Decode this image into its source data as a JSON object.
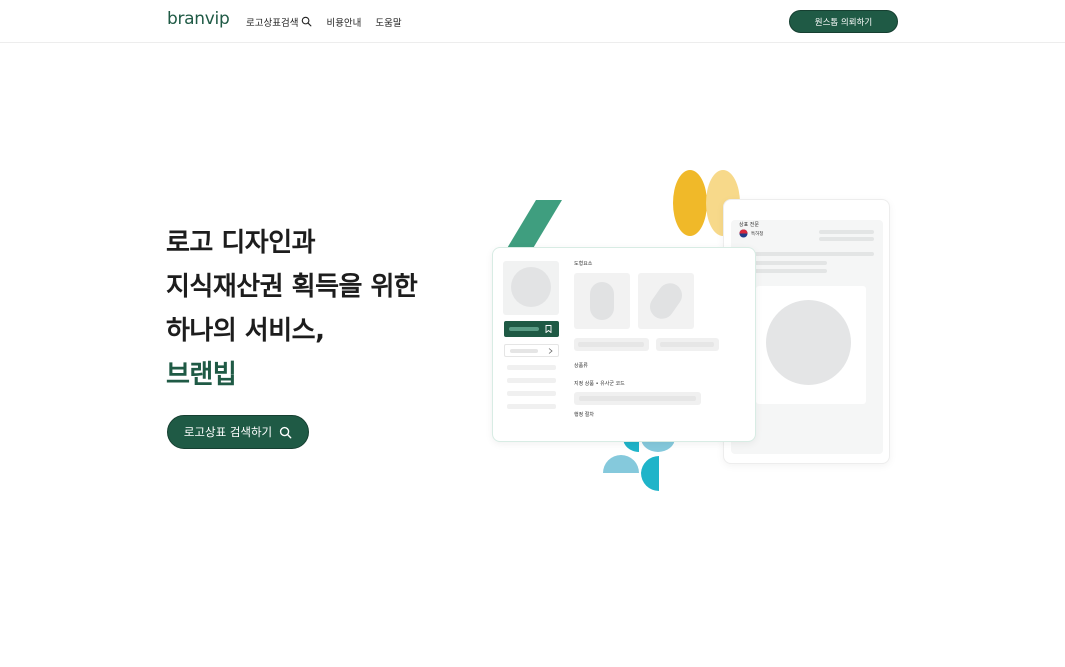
{
  "header": {
    "logo": "branvip",
    "nav": [
      {
        "label": "로고상표검색"
      },
      {
        "label": "비용안내"
      },
      {
        "label": "도움말"
      }
    ],
    "cta_label": "원스톱 의뢰하기"
  },
  "hero": {
    "line1": "로고 디자인과",
    "line2": "지식재산권 획득을 위한",
    "line3": "하나의 서비스,",
    "brand": "브랜빕",
    "cta_label": "로고상표 검색하기"
  },
  "illustration": {
    "card_a": {
      "section_shape": "도형요소",
      "section_class": "상품류",
      "section_goods": "지정 상품 • 유사군 코드",
      "section_procedure": "행정 절차"
    },
    "card_b": {
      "title": "상표 전문",
      "office": "특허청"
    }
  },
  "colors": {
    "brand_green": "#1f5a45",
    "accent_teal": "#3f9e7f",
    "yellow": "#f0b929",
    "light_yellow": "#f7d98a",
    "cyan": "#1fb4c9",
    "light_cyan": "#85c9dc"
  }
}
